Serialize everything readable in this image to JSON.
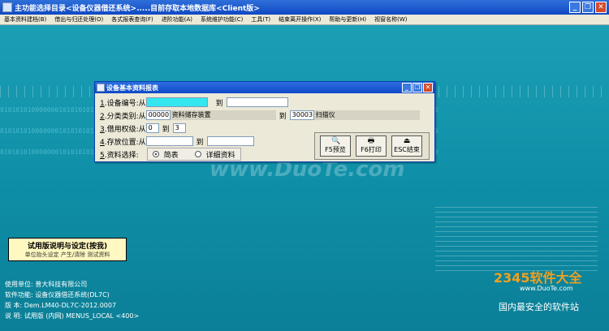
{
  "window": {
    "title": "主功能选择目录<设备仪器借还系统>.....目前存取本地数据库<Client版>"
  },
  "menu": [
    "基本资料建档(B)",
    "借出与归还处理(O)",
    "各式报表查询(F)",
    "进阶功能(A)",
    "系统维护功能(C)",
    "工具(T)",
    "结束离开操作(X)",
    "帮助与更新(H)",
    "视窗名称(W)"
  ],
  "dialog": {
    "title": "设备基本资料报表",
    "row1": {
      "num": "1",
      "label": ".设备编号:从",
      "from": "",
      "to_label": "到",
      "to": ""
    },
    "row2": {
      "num": "2",
      "label": ".分类类别:从",
      "from_code": "00000",
      "from_name": "资料储存装置",
      "to_label": "到",
      "to_code": "30003",
      "to_name": "扫描仪"
    },
    "row3": {
      "num": "3",
      "label": ".借用权级:从",
      "from": "0",
      "to_label": "到",
      "to": "3"
    },
    "row4": {
      "num": "4",
      "label": ".存放位置:从",
      "from": "",
      "to_label": "到",
      "to": ""
    },
    "row5": {
      "num": "5",
      "label": ".资料选择:",
      "opt1": "简表",
      "opt2": "详细资料"
    },
    "buttons": {
      "preview": "F5预览",
      "print": "F6打印",
      "exit": "ESC结束"
    }
  },
  "binary_text": "0101010100000001010101010100010101010000000101010101010001010101000000010101010101000101010100000001010101010100",
  "trial": {
    "title": "试用版说明与设定(按我)",
    "sub": "单位抬头设定 产生/清除 测试资料"
  },
  "info": {
    "l1": "使用单位: 普大科技有限公司",
    "l2": "软件功能: 设备仪器借还系统(DL7C)",
    "l3": "版    本: Dem.LM40-DL7C-2012.0007",
    "l4": "说    明: 试用版 (内网) MENUS_LOCAL <400>"
  },
  "watermark": "www.DuoTe.com",
  "brand": {
    "name": "2345软件大全",
    "url": "www.DuoTe.com",
    "slogan": "国内最安全的软件站"
  }
}
